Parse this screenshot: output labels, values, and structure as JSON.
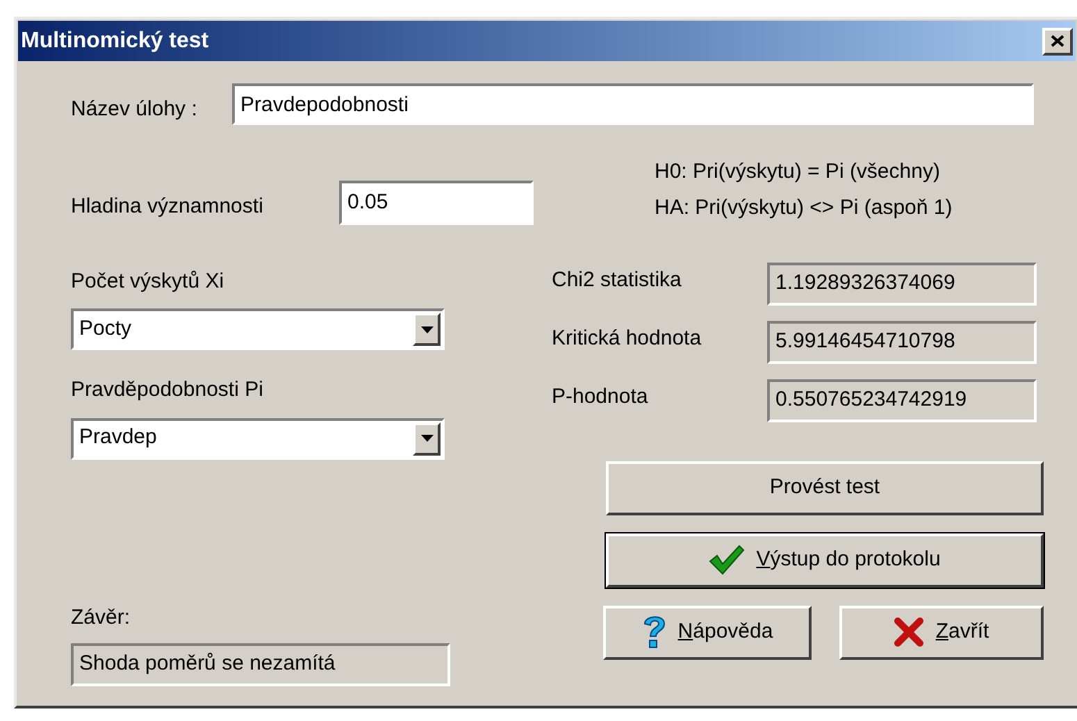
{
  "window": {
    "title": "Multinomický test"
  },
  "task_name": {
    "label": "Název úlohy :",
    "value": "Pravdepodobnosti"
  },
  "significance": {
    "label": "Hladina významnosti",
    "value": "0.05"
  },
  "hypotheses": [
    "H0: Pri(výskytu) = Pi (všechny)",
    "HA: Pri(výskytu) <> Pi (aspoň 1)"
  ],
  "selects": [
    {
      "label": "Počet výskytů Xi",
      "value": "Pocty"
    },
    {
      "label": "Pravděpodobnosti Pi",
      "value": "Pravdep"
    }
  ],
  "results": [
    {
      "label": "Chi2 statistika",
      "value": "1.19289326374069"
    },
    {
      "label": "Kritická hodnota",
      "value": "5.99146454710798"
    },
    {
      "label": "P-hodnota",
      "value": "0.550765234742919"
    }
  ],
  "conclusion": {
    "label": "Závěr:",
    "value": "Shoda poměrů se nezamítá"
  },
  "buttons": [
    {
      "label": "Provést test",
      "kind": "plain",
      "default": false,
      "underline_first": false
    },
    {
      "label": "Výstup do protokolu",
      "kind": "check",
      "default": true,
      "underline_first": true
    },
    {
      "label": "Nápověda",
      "kind": "help",
      "default": false,
      "underline_first": true
    },
    {
      "label": "Zavřít",
      "kind": "close",
      "default": false,
      "underline_first": true
    }
  ]
}
